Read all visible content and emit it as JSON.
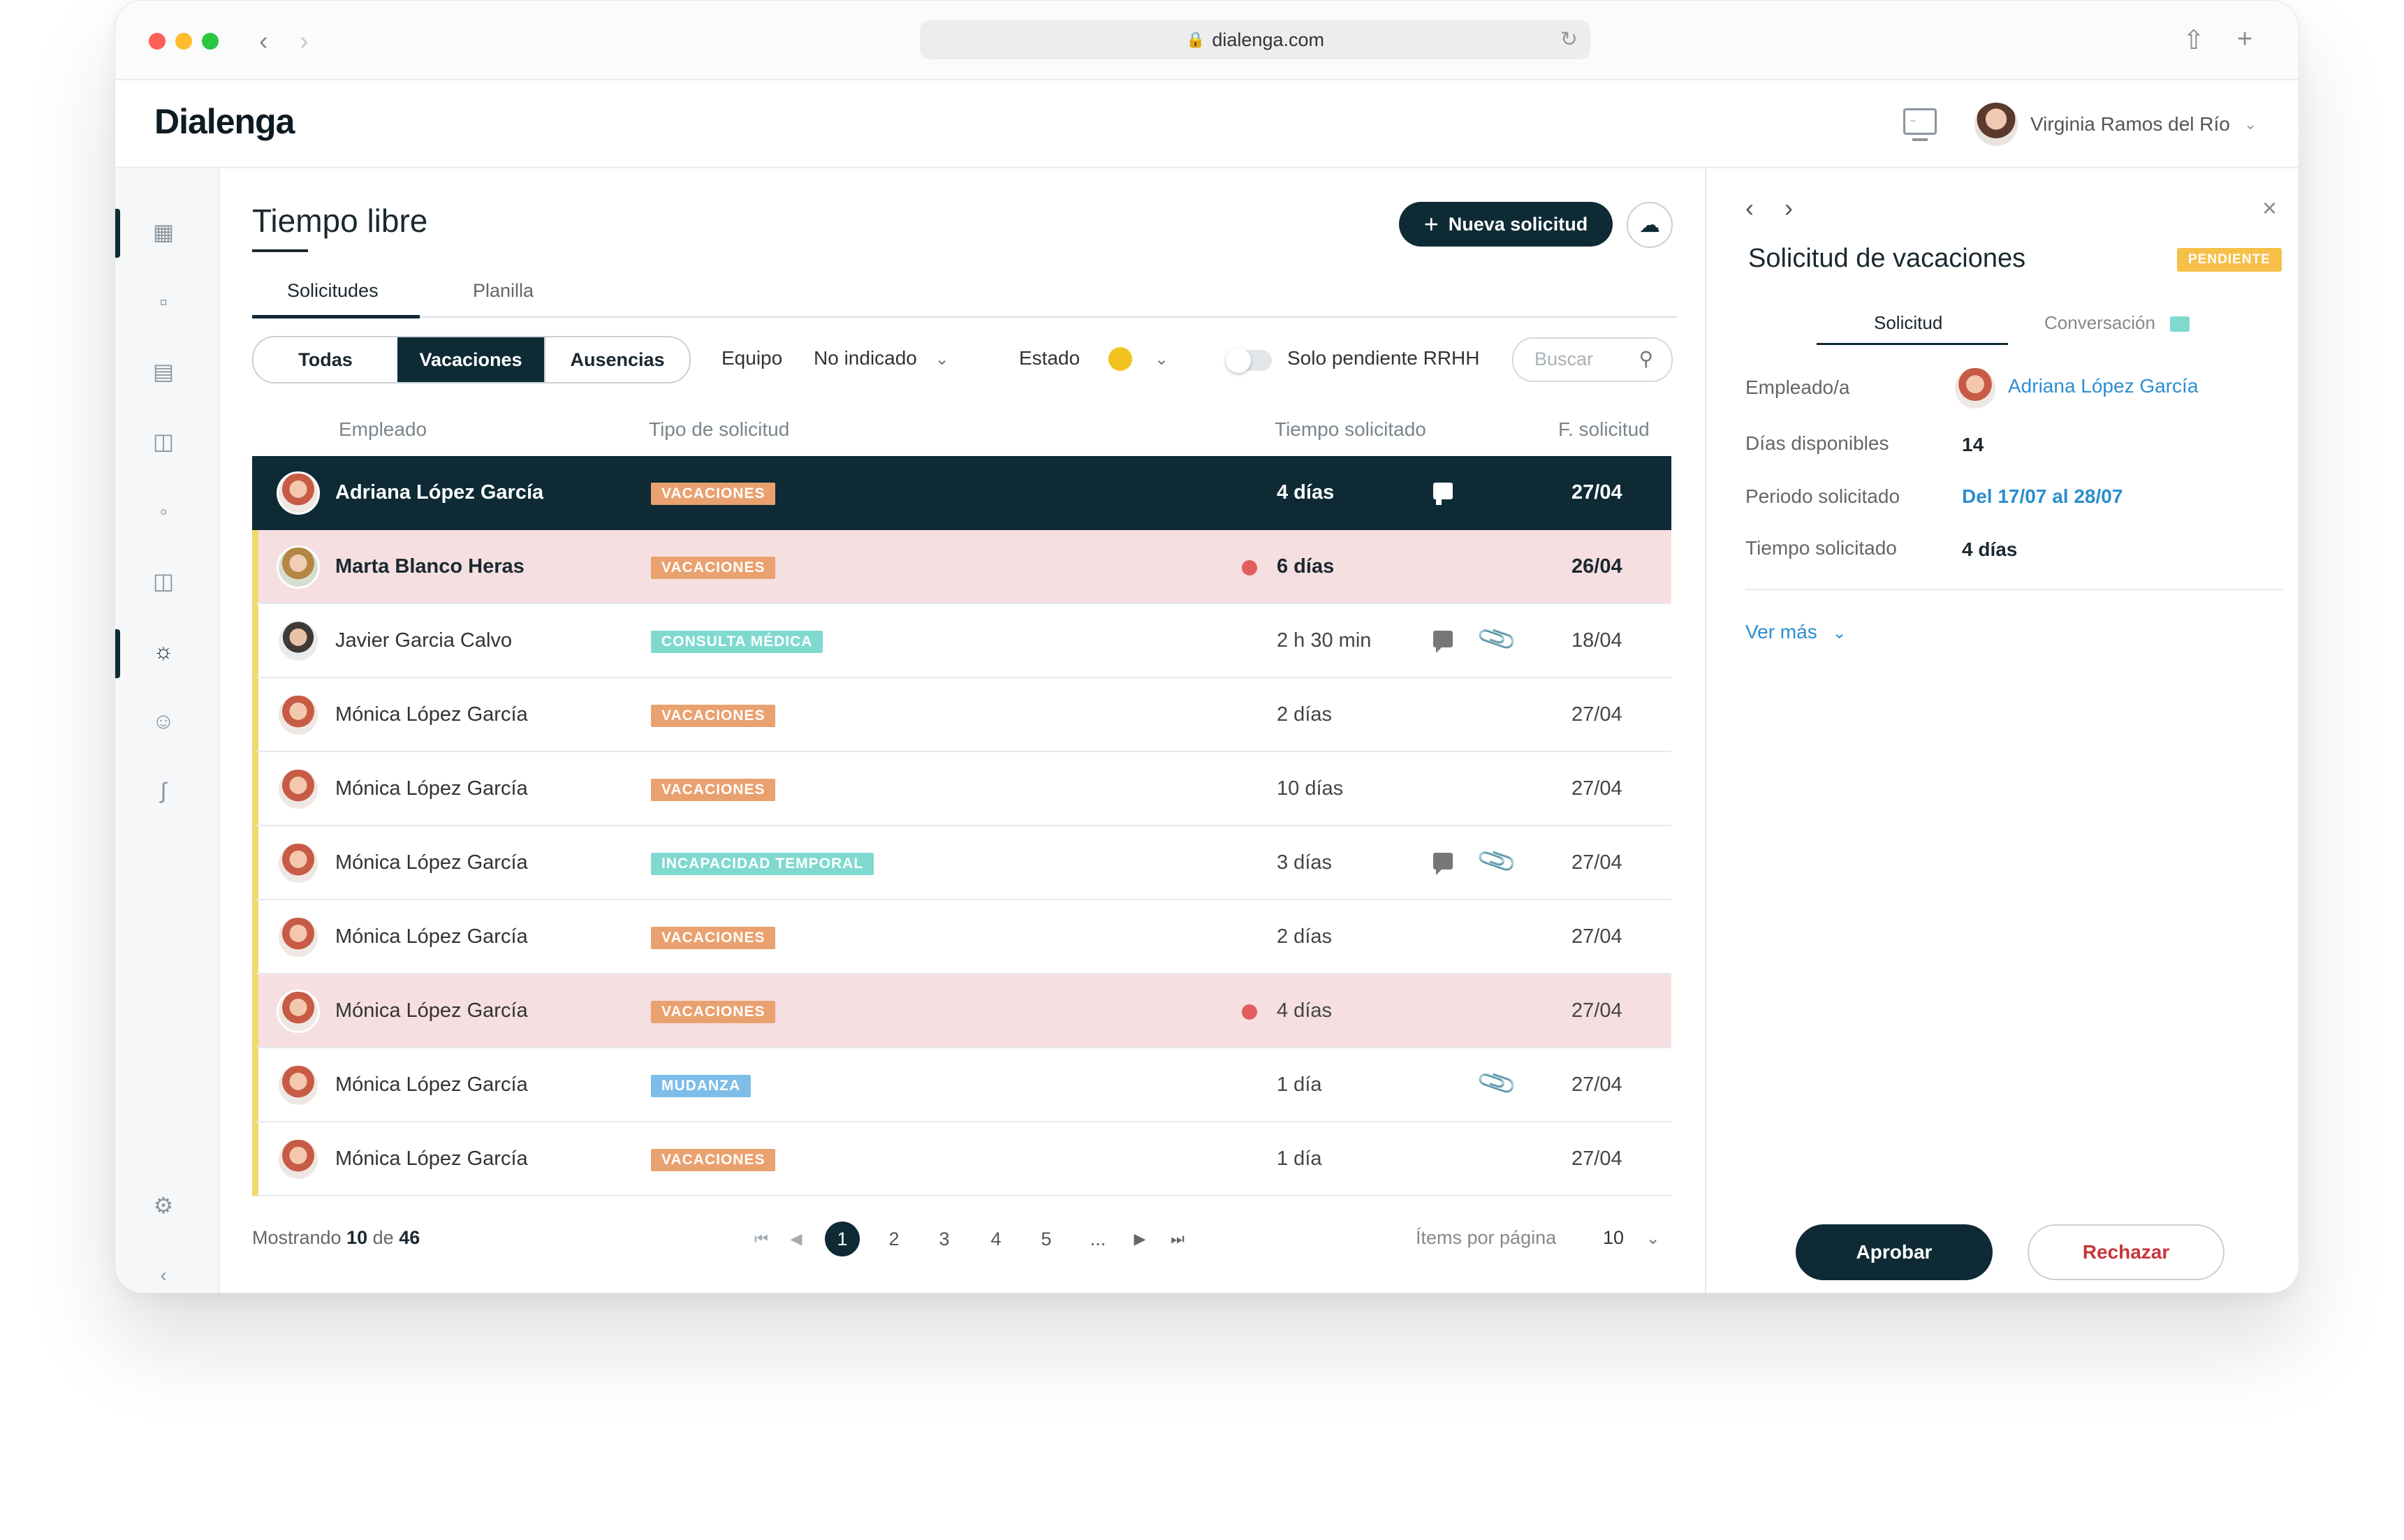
{
  "browser": {
    "url": "dialenga.com"
  },
  "app": {
    "logo": "Dialenga",
    "user_name": "Virginia Ramos del Río"
  },
  "page": {
    "title": "Tiempo libre",
    "new_button": "Nueva solicitud",
    "tabs": [
      "Solicitudes",
      "Planilla"
    ],
    "segments": [
      "Todas",
      "Vacaciones",
      "Ausencias"
    ],
    "filters": {
      "equipo_label": "Equipo",
      "equipo_value": "No indicado",
      "estado_label": "Estado",
      "pending_toggle_label": "Solo pendiente RRHH",
      "search_placeholder": "Buscar"
    },
    "columns": [
      "Empleado",
      "Tipo de solicitud",
      "Tiempo solicitado",
      "F. solicitud"
    ],
    "rows": [
      {
        "name": "Adriana López García",
        "type": "VACACIONES",
        "time": "4 días",
        "date": "27/04"
      },
      {
        "name": "Marta Blanco Heras",
        "type": "VACACIONES",
        "time": "6 días",
        "date": "26/04"
      },
      {
        "name": "Javier Garcia Calvo",
        "type": "CONSULTA MÉDICA",
        "time": "2 h 30 min",
        "date": "18/04"
      },
      {
        "name": "Mónica López García",
        "type": "VACACIONES",
        "time": "2 días",
        "date": "27/04"
      },
      {
        "name": "Mónica López García",
        "type": "VACACIONES",
        "time": "10 días",
        "date": "27/04"
      },
      {
        "name": "Mónica López García",
        "type": "INCAPACIDAD TEMPORAL",
        "time": "3 días",
        "date": "27/04"
      },
      {
        "name": "Mónica López García",
        "type": "VACACIONES",
        "time": "2 días",
        "date": "27/04"
      },
      {
        "name": "Mónica López García",
        "type": "VACACIONES",
        "time": "4 días",
        "date": "27/04"
      },
      {
        "name": "Mónica López García",
        "type": "MUDANZA",
        "time": "1 día",
        "date": "27/04"
      },
      {
        "name": "Mónica López García",
        "type": "VACACIONES",
        "time": "1 día",
        "date": "27/04"
      }
    ],
    "footer": {
      "showing_prefix": "Mostrando",
      "showing_count": "10",
      "of_label": "de",
      "total": "46",
      "pages": [
        "1",
        "2",
        "3",
        "4",
        "5",
        "..."
      ],
      "per_page_label": "Ítems por página",
      "per_page_value": "10"
    }
  },
  "panel": {
    "title": "Solicitud de vacaciones",
    "badge": "PENDIENTE",
    "tabs": [
      "Solicitud",
      "Conversación"
    ],
    "fields": {
      "empleado_label": "Empleado/a",
      "empleado_value": "Adriana López García",
      "dias_label": "Días disponibles",
      "dias_value": "14",
      "periodo_label": "Periodo solicitado",
      "periodo_value": "Del 17/07 al 28/07",
      "tiempo_label": "Tiempo solicitado",
      "tiempo_value": "4 días"
    },
    "ver_mas": "Ver más",
    "approve": "Aprobar",
    "reject": "Rechazar"
  },
  "colors": {
    "brand": "#0e2a35",
    "pending": "#f6c049",
    "vacaciones_tag": "#e9a16f",
    "medical_tag": "#7fd9cf",
    "moving_tag": "#7dbde8",
    "reject": "#c9353b"
  }
}
